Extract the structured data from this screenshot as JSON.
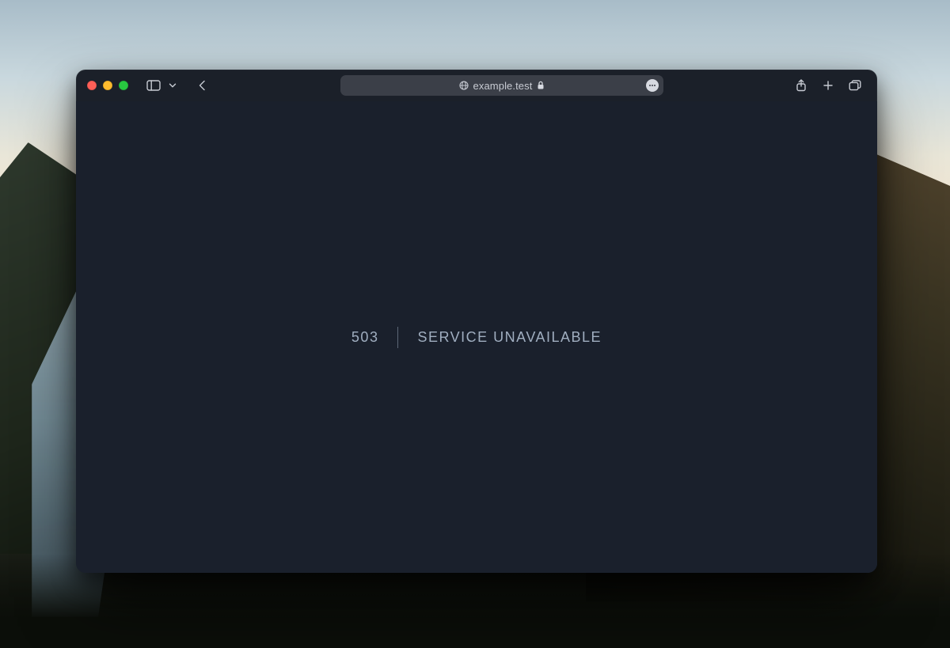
{
  "browser": {
    "address": {
      "host": "example.test"
    }
  },
  "page": {
    "error": {
      "code": "503",
      "message": "Service Unavailable"
    }
  }
}
